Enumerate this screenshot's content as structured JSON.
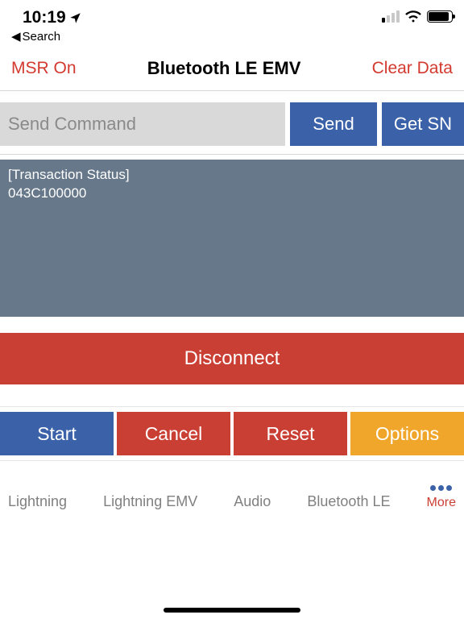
{
  "status": {
    "time": "10:19",
    "back_label": "Search"
  },
  "nav": {
    "left": "MSR On",
    "title": "Bluetooth LE EMV",
    "right": "Clear Data"
  },
  "command": {
    "placeholder": "Send Command",
    "send_label": "Send",
    "getsn_label": "Get SN"
  },
  "console_text": "[Transaction Status]\n043C100000",
  "disconnect_label": "Disconnect",
  "actions": {
    "start": "Start",
    "cancel": "Cancel",
    "reset": "Reset",
    "options": "Options"
  },
  "tabs": {
    "lightning": "Lightning",
    "lightning_emv": "Lightning EMV",
    "audio": "Audio",
    "bluetooth_le": "Bluetooth LE",
    "more": "More"
  }
}
